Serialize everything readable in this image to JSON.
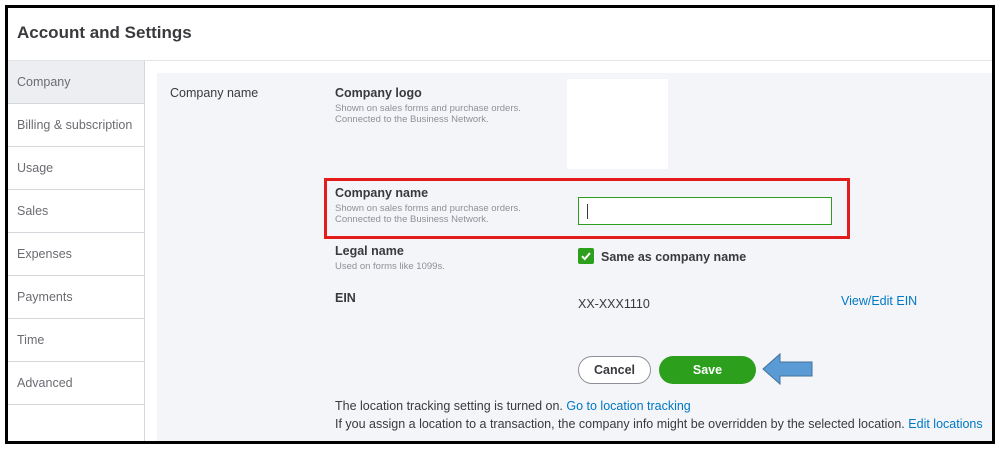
{
  "header": {
    "title": "Account and Settings"
  },
  "sidebar": {
    "items": [
      {
        "label": "Company"
      },
      {
        "label": "Billing & subscription"
      },
      {
        "label": "Usage"
      },
      {
        "label": "Sales"
      },
      {
        "label": "Expenses"
      },
      {
        "label": "Payments"
      },
      {
        "label": "Time"
      },
      {
        "label": "Advanced"
      }
    ]
  },
  "section": {
    "label": "Company name"
  },
  "logo": {
    "title": "Company logo",
    "help1": "Shown on sales forms and purchase orders.",
    "help2": "Connected to the Business Network."
  },
  "company_name": {
    "title": "Company name",
    "help1": "Shown on sales forms and purchase orders.",
    "help2": "Connected to the Business Network.",
    "value": ""
  },
  "legal_name": {
    "title": "Legal name",
    "help": "Used on forms like 1099s.",
    "checkbox_label": "Same as company name",
    "checked": true
  },
  "ein": {
    "title": "EIN",
    "value": "XX-XXX1110",
    "link": "View/Edit EIN"
  },
  "actions": {
    "cancel_label": "Cancel",
    "save_label": "Save"
  },
  "location": {
    "line1_text": "The location tracking setting is turned on.",
    "line1_link": "Go to location tracking",
    "line2_text": "If you assign a location to a transaction, the company info might be overridden by the selected location.",
    "line2_link": "Edit locations"
  },
  "colors": {
    "accent_green": "#2ca01c",
    "link_blue": "#0077c5",
    "highlight_red": "#e31c1c",
    "arrow_blue": "#5b9bd5"
  }
}
